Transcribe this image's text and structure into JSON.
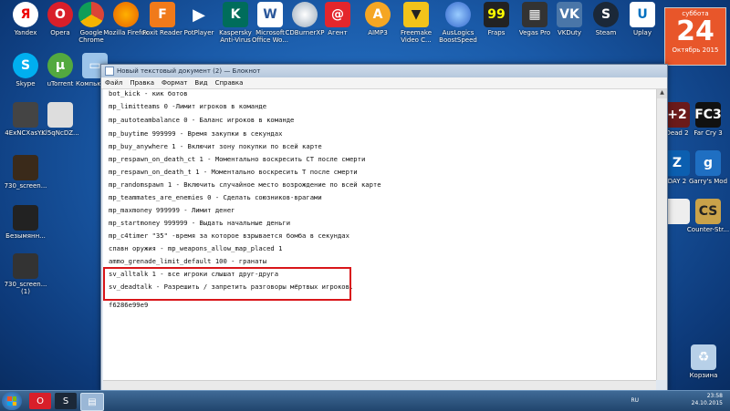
{
  "desktop_icons": {
    "yandex": "Yandex",
    "opera": "Opera",
    "google_chrome": "Google Chrome",
    "mozilla_firefox": "Mozilla Firefox",
    "foxit_reader": "Foxit Reader",
    "potplayer": "PotPlayer",
    "kaspersky": "Kaspersky Anti-Virus",
    "office_word": "Microsoft Office Wo...",
    "cdburnerxp": "CDBurnerXP",
    "mailru_agent": "Агент",
    "aimp3": "AIMP3",
    "freemake": "Freemake Video C...",
    "auslogics": "AusLogics BoostSpeed",
    "fraps": "Fraps",
    "vegas_pro": "Vegas Pro",
    "vkduty": "VKDuty",
    "steam": "Steam",
    "uplay": "Uplay",
    "skype": "Skype",
    "utorrent": "uTorrent",
    "computer": "Компьютер",
    "file1": "4ExNCXasY...",
    "file2": "Kl5qNcDZ...",
    "file3": "730_screen...",
    "file4": "Безымянн...",
    "file5": "730_screen... (1)",
    "dead2": "Dead 2",
    "farcry3": "Far Cry 3",
    "day2": "DAY 2",
    "garrysmod": "Garry's Mod",
    "counterstrike": "Counter-Str...",
    "recycle": "Корзина"
  },
  "calendar": {
    "weekday": "суббота",
    "day": "24",
    "month": "Октябрь 2015"
  },
  "window": {
    "title": "Новый текстовый документ (2) — Блокнот",
    "menu": [
      "Файл",
      "Правка",
      "Формат",
      "Вид",
      "Справка"
    ]
  },
  "notepad_lines": [
    "bot_kick - кик ботов",
    "mp_limitteams 0 -Лимит игроков в команде",
    "mp_autoteambalance 0 - Баланс игроков в команде",
    "mp_buytime 999999 - Время закупки в секундах",
    "mp_buy_anywhere 1 - Включит зону покупки по всей карте",
    "mp_respawn_on_death_ct 1 - Моментально воскресить CT после смерти",
    "mp_respawn_on_death_t 1 - Моментально воскресить T после смерти",
    "mp_randomspawn 1 - Включить случайное место возрождение по всей карте",
    "mp_teammates_are_enemies 0 - Сделать союзников-врагами",
    "mp_maxmoney 999999 - Лимит денег",
    "mp_startmoney 999999 - Выдать начальные деньги",
    "mp_c4timer \"35\" -время за которое взрывается бомба в секундах",
    "спавн оружия - mp_weapons_allow_map_placed 1",
    "ammo_grenade_limit_default 100 - гранаты",
    "sv_alltalk 1 - все игроки слышат друг-друга",
    "sv_deadtalk - Разрешить / запретить разговоры мёртвых игроков.",
    "f6286e99e9"
  ],
  "taskbar": {
    "language": "RU",
    "time": "23:58",
    "date": "24.10.2015"
  },
  "colors": {
    "highlight": "#d9161a",
    "calendar": "#e8562a"
  }
}
